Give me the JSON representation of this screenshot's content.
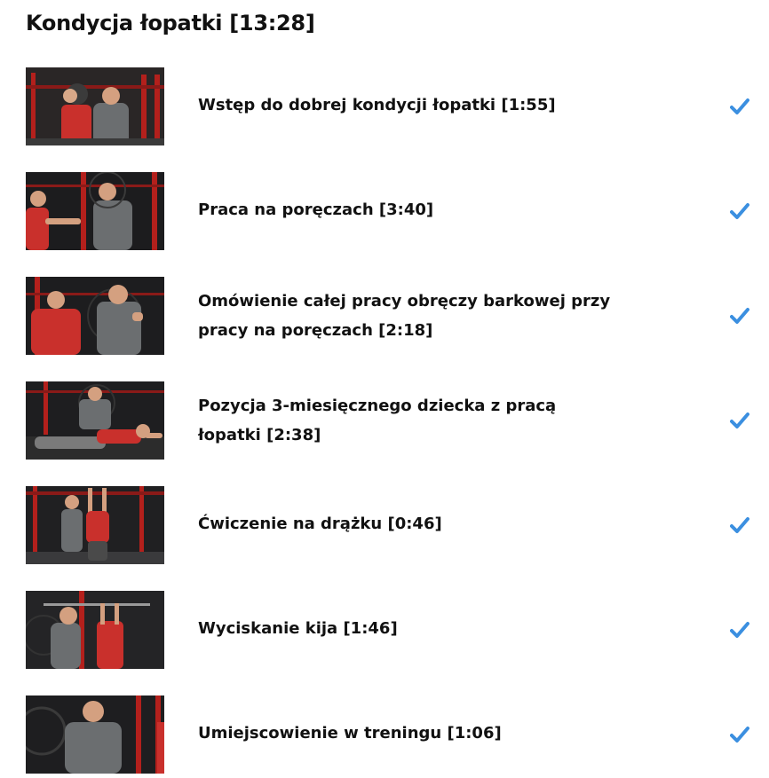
{
  "section": {
    "title": "Kondycja łopatki [13:28]"
  },
  "accent_color": "#3b8fe0",
  "lessons": [
    {
      "label": "Wstęp do dobrej kondycji łopatki [1:55]",
      "completed": true,
      "icon": "check-icon"
    },
    {
      "label": "Praca na poręczach [3:40]",
      "completed": true,
      "icon": "check-icon"
    },
    {
      "label": "Omówienie całej pracy obręczy barkowej przy pracy na poręczach [2:18]",
      "completed": true,
      "icon": "check-icon"
    },
    {
      "label": "Pozycja 3-miesięcznego dziecka z pracą łopatki [2:38]",
      "completed": true,
      "icon": "check-icon"
    },
    {
      "label": "Ćwiczenie na drążku [0:46]",
      "completed": true,
      "icon": "check-icon"
    },
    {
      "label": "Wyciskanie kija [1:46]",
      "completed": true,
      "icon": "check-icon"
    },
    {
      "label": "Umiejscowienie w treningu [1:06]",
      "completed": true,
      "icon": "check-icon"
    }
  ]
}
